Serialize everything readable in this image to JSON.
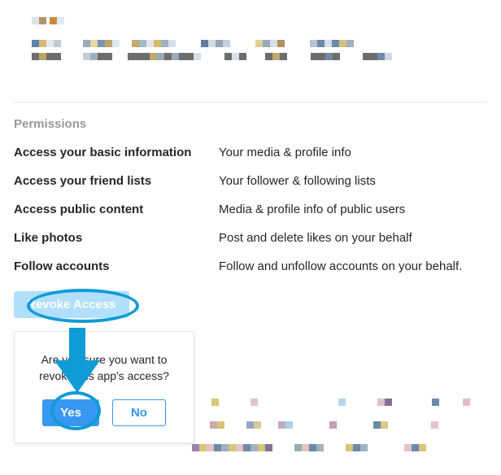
{
  "section_title": "Permissions",
  "permissions": [
    {
      "name": "Access your basic information",
      "desc": "Your media & profile info"
    },
    {
      "name": "Access your friend lists",
      "desc": "Your follower & following lists"
    },
    {
      "name": "Access public content",
      "desc": "Media & profile info of public users"
    },
    {
      "name": "Like photos",
      "desc": "Post and delete likes on your behalf"
    },
    {
      "name": "Follow accounts",
      "desc": "Follow and unfollow accounts on your behalf."
    }
  ],
  "revoke_button": "Revoke Access",
  "popover": {
    "message": "Are you sure you want to revoke this app's access?",
    "yes": "Yes",
    "no": "No"
  },
  "annotation_color": "#0f9bd7"
}
